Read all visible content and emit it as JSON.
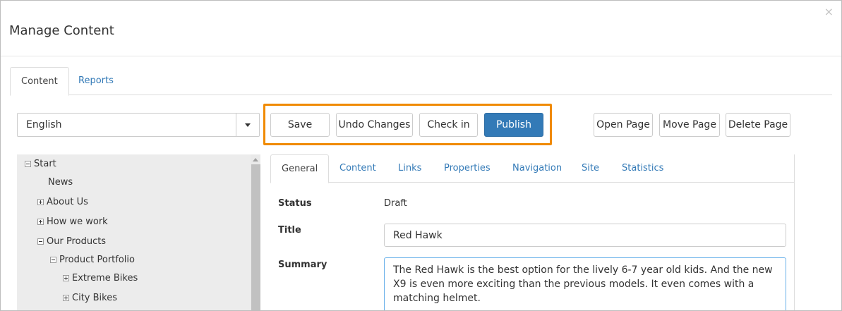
{
  "dialog": {
    "title": "Manage Content",
    "close_glyph": "×"
  },
  "top_tabs": [
    {
      "label": "Content"
    },
    {
      "label": "Reports"
    }
  ],
  "language": {
    "selected": "English"
  },
  "toolbar": {
    "save": "Save",
    "undo": "Undo Changes",
    "checkin": "Check in",
    "publish": "Publish",
    "open_page": "Open Page",
    "move_page": "Move Page",
    "delete_page": "Delete Page"
  },
  "colors": {
    "highlight": "#f08a00",
    "primary": "#337ab7",
    "link": "#337ab7"
  },
  "tree": [
    {
      "label": "Start",
      "toggle": "minus"
    },
    {
      "label": "News",
      "toggle": "none"
    },
    {
      "label": "About Us",
      "toggle": "plus"
    },
    {
      "label": "How we work",
      "toggle": "plus"
    },
    {
      "label": "Our Products",
      "toggle": "minus"
    },
    {
      "label": "Product Portfolio",
      "toggle": "minus"
    },
    {
      "label": "Extreme Bikes",
      "toggle": "plus"
    },
    {
      "label": "City Bikes",
      "toggle": "plus"
    }
  ],
  "detail_tabs": [
    {
      "label": "General"
    },
    {
      "label": "Content"
    },
    {
      "label": "Links"
    },
    {
      "label": "Properties"
    },
    {
      "label": "Navigation"
    },
    {
      "label": "Site"
    },
    {
      "label": "Statistics"
    }
  ],
  "general": {
    "status_label": "Status",
    "status_value": "Draft",
    "title_label": "Title",
    "title_value": "Red Hawk",
    "summary_label": "Summary",
    "summary_value": "The Red Hawk is the best option for the lively 6-7 year old kids. And the new X9 is even more exciting than the previous models. It even comes with a matching helmet."
  }
}
